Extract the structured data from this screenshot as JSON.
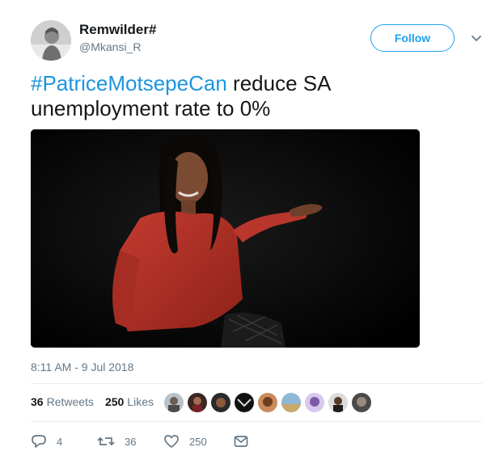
{
  "author": {
    "name": "Remwilder#",
    "handle": "@Mkansi_R",
    "avatar_icon": "user-avatar"
  },
  "follow_label": "Follow",
  "tweet": {
    "hashtag": "#PatriceMotsepeCan",
    "text": " reduce SA unemployment rate to 0%"
  },
  "media": {
    "icon": "photo-woman-red-dress"
  },
  "timestamp": "8:11 AM - 9 Jul 2018",
  "stats": {
    "retweets_count": "36",
    "retweets_label": "Retweets",
    "likes_count": "250",
    "likes_label": "Likes"
  },
  "actions": {
    "replies": "4",
    "retweets": "36",
    "likes": "250"
  },
  "colors": {
    "accent": "#1da1f2",
    "hashtag": "#1b95e0",
    "muted": "#657786",
    "text": "#14171a"
  }
}
